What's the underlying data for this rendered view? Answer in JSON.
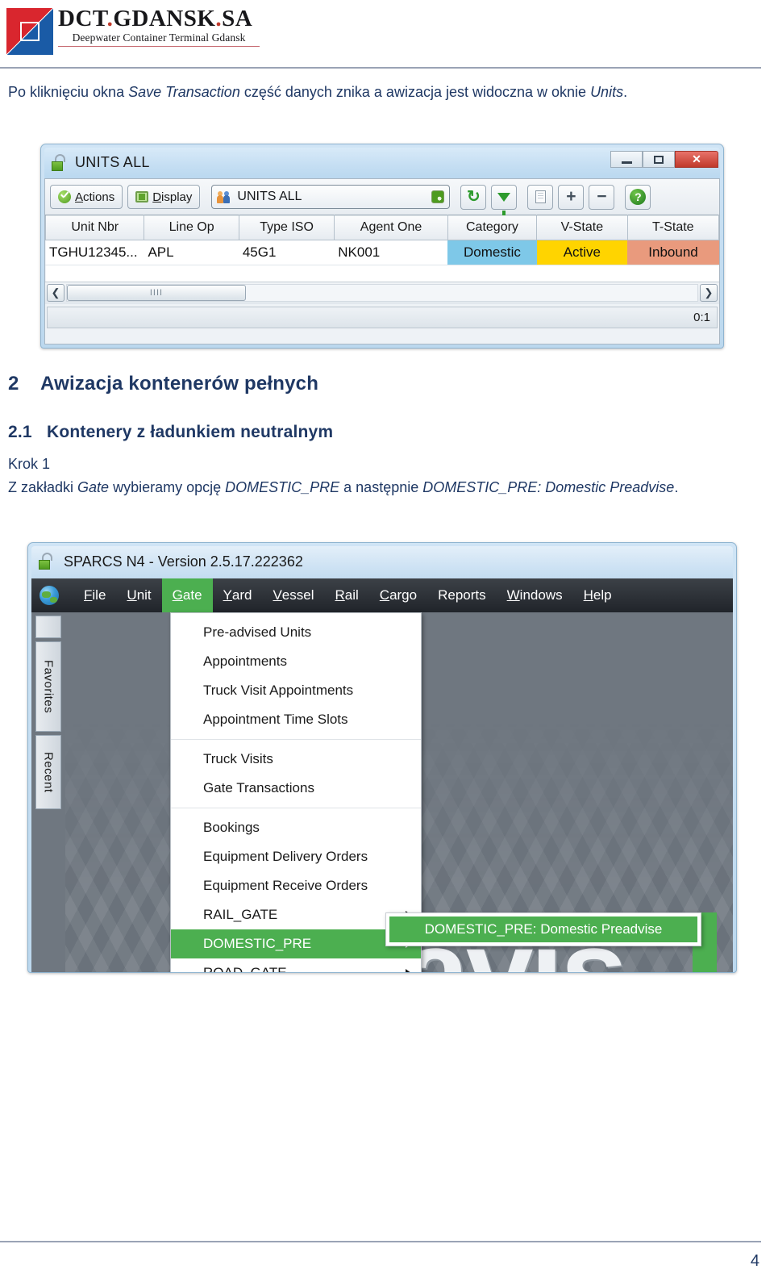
{
  "header": {
    "brand_main": "DCT",
    "brand_dot1": ".",
    "brand_city": "GDANSK",
    "brand_dot2": ".",
    "brand_suffix": "SA",
    "brand_tagline": "Deepwater Container Terminal Gdansk",
    "logo_icon": "dct-diagonal-square-logo"
  },
  "intro": {
    "line_a": "Po kliknięciu okna ",
    "em_a": "Save Transaction",
    "line_b": " część danych znika a awizacja jest widoczna w oknie ",
    "em_b": "Units",
    "line_c": "."
  },
  "sections": {
    "h1_num": "2",
    "h1_text": "Awizacja kontenerów pełnych",
    "h2_num": "2.1",
    "h2_text": "Kontenery z ładunkiem neutralnym",
    "krok": "Krok 1",
    "step_a": "Z zakładki ",
    "step_em_a": "Gate",
    "step_b": " wybieramy opcję ",
    "step_em_b": "DOMESTIC_PRE",
    "step_c": " a następnie ",
    "step_em_c": "DOMESTIC_PRE: Domestic Preadvise",
    "step_d": "."
  },
  "units_window": {
    "title": "UNITS ALL",
    "lock_icon": "green-open-padlock-icon",
    "minimize_label": "Minimize",
    "maximize_label": "Maximize",
    "close_label": "✕",
    "toolbar": {
      "actions_mnemonic": "A",
      "actions_rest": "ctions",
      "display_mnemonic": "D",
      "display_rest": "isplay",
      "combo_value": "UNITS ALL",
      "refresh_icon": "↻",
      "plus_icon": "+",
      "minus_icon": "−",
      "help_icon": "?"
    },
    "table": {
      "columns": [
        "Unit Nbr",
        "Line Op",
        "Type ISO",
        "Agent One",
        "Category",
        "V-State",
        "T-State"
      ],
      "rows": [
        {
          "unit_nbr": "TGHU12345...",
          "line_op": "APL",
          "type_iso": "45G1",
          "agent_one": "NK001",
          "category": "Domestic",
          "v_state": "Active",
          "t_state": "Inbound"
        }
      ]
    },
    "scrollbar": {
      "left_arrow": "❮",
      "right_arrow": "❯",
      "grip": "IIII"
    },
    "status": "0:1",
    "colors": {
      "category_bg": "#7ec8e8",
      "vstate_bg": "#ffd400",
      "tstate_bg": "#e99a7d",
      "close_bg": "#c0392b"
    }
  },
  "sparcs_window": {
    "title": "SPARCS N4 - Version 2.5.17.222362",
    "globe_icon": "globe-icon",
    "menubar": [
      {
        "mnemonic": "F",
        "rest": "ile",
        "active": false
      },
      {
        "mnemonic": "U",
        "rest": "nit",
        "active": false
      },
      {
        "mnemonic": "G",
        "rest": "ate",
        "active": true
      },
      {
        "mnemonic": "Y",
        "rest": "ard",
        "active": false
      },
      {
        "mnemonic": "V",
        "rest": "essel",
        "active": false
      },
      {
        "mnemonic": "R",
        "rest": "ail",
        "active": false
      },
      {
        "mnemonic": "C",
        "rest": "argo",
        "active": false
      },
      {
        "mnemonic": "",
        "rest": "Reports",
        "active": false
      },
      {
        "mnemonic": "W",
        "rest": "indows",
        "active": false
      },
      {
        "mnemonic": "H",
        "rest": "elp",
        "active": false
      }
    ],
    "sidebar_tabs": [
      "Favorites",
      "Recent"
    ],
    "dropdown": {
      "group1": [
        "Pre-advised Units",
        "Appointments",
        "Truck Visit Appointments",
        "Appointment Time Slots"
      ],
      "group2": [
        "Truck Visits",
        "Gate Transactions"
      ],
      "group3": [
        {
          "label": "Bookings",
          "submenu": false,
          "selected": false
        },
        {
          "label": "Equipment Delivery Orders",
          "submenu": false,
          "selected": false
        },
        {
          "label": "Equipment Receive Orders",
          "submenu": false,
          "selected": false
        },
        {
          "label": "RAIL_GATE",
          "submenu": true,
          "selected": false
        },
        {
          "label": "DOMESTIC_PRE",
          "submenu": true,
          "selected": true
        },
        {
          "label": "ROAD_GATE",
          "submenu": true,
          "selected": false
        }
      ]
    },
    "submenu_item": "DOMESTIC_PRE: Domestic Preadvise",
    "watermark_text": "navis",
    "accent_green": "#4caf50"
  },
  "footer": {
    "page_number": "4"
  }
}
